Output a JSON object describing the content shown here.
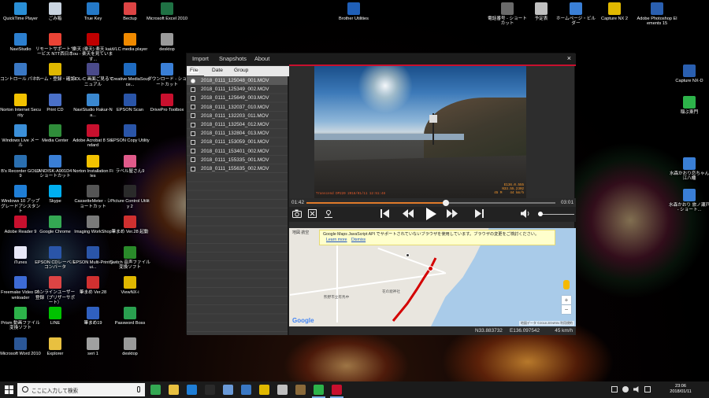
{
  "desktop": {
    "icons_col1": [
      {
        "label": "QuickTime Player",
        "color": "#2a8fd6"
      },
      {
        "label": "NaviStudio",
        "color": "#2c7fcf"
      },
      {
        "label": "コントロール パネル",
        "color": "#3a78c4"
      },
      {
        "label": "Norton Internet Security",
        "color": "#f2c200"
      },
      {
        "label": "Windows Live メール",
        "color": "#3b8fd8"
      },
      {
        "label": "B's Recorder GOLD9",
        "color": "#2a6fb0"
      },
      {
        "label": "Windows 10 アップグレードアシスタント",
        "color": "#1f7ed6"
      },
      {
        "label": "Adobe Reader 9",
        "color": "#c8102e"
      },
      {
        "label": "iTunes",
        "color": "#e8e8f8"
      },
      {
        "label": "Freemake Video Downloader",
        "color": "#3d6bd6"
      },
      {
        "label": "Prism 動画ファイル変換ソフト",
        "color": "#2db34a"
      },
      {
        "label": "Microsoft Word 2010",
        "color": "#2b5797"
      }
    ],
    "icons_col2": [
      {
        "label": "ごみ箱",
        "color": "#c9d4e0"
      },
      {
        "label": "リモートサポートサービス NTT西日本",
        "color": "#ea4335"
      },
      {
        "label": "ホーム・登録・確認",
        "color": "#e0b800"
      },
      {
        "label": "Print CD",
        "color": "#4a70c8"
      },
      {
        "label": "Media Center",
        "color": "#2f8d3a"
      },
      {
        "label": "LANDISK-A901D4 - ショートカット",
        "color": "#3a7fd6"
      },
      {
        "label": "Skype",
        "color": "#00aff0"
      },
      {
        "label": "Google Chrome",
        "color": "#34a853"
      },
      {
        "label": "EPSON CDレーベルコンバータ",
        "color": "#2a55a8"
      },
      {
        "label": "オンラインユーザー登録（プリザーサポート）",
        "color": "#d44"
      },
      {
        "label": "LINE",
        "color": "#00c300"
      },
      {
        "label": "Explorer",
        "color": "#e8c040"
      }
    ],
    "icons_col3": [
      {
        "label": "True Key",
        "color": "#2479c8"
      },
      {
        "label": "楽天 (楽天) 楽天 kaizou - 楽天を見ています...",
        "color": "#bf0000"
      },
      {
        "label": "HDL-C 画面ご見るマニュアル",
        "color": "#4a4a8a"
      },
      {
        "label": "NaviStudio Rakur-Na...",
        "color": "#3a88d0"
      },
      {
        "label": "Adobe Acrobat 8 Standard",
        "color": "#c8102e"
      },
      {
        "label": "Norton Installation Files",
        "color": "#f2c200"
      },
      {
        "label": "CassetteMeter - ショートカット",
        "color": "#555"
      },
      {
        "label": "Imaging WorkShop",
        "color": "#7a7a7a"
      },
      {
        "label": "EPSON Multi-PrintQui...",
        "color": "#2a55a8"
      },
      {
        "label": "筆まめ Ver.28",
        "color": "#d03030"
      },
      {
        "label": "筆まめ19",
        "color": "#3060c0"
      },
      {
        "label": "seri 1",
        "color": "#a0a0a0"
      }
    ],
    "icons_col4": [
      {
        "label": "Bectup",
        "color": "#dd4444"
      },
      {
        "label": "VLC media player",
        "color": "#f08a00"
      },
      {
        "label": "Creative MediaSource...",
        "color": "#1f6bc0"
      },
      {
        "label": "EPSON Scan",
        "color": "#2a55a8"
      },
      {
        "label": "EPSON Copy Utility",
        "color": "#2a55a8"
      },
      {
        "label": "ラベル屋さん9",
        "color": "#e05a8a"
      },
      {
        "label": "Picture Control Utility 2",
        "color": "#2a2a2a"
      },
      {
        "label": "筆まめ Ver.28 起動",
        "color": "#d03030"
      },
      {
        "label": "Switch 音声ファイル変換ソフト",
        "color": "#2a8a2a"
      },
      {
        "label": "ViewNX-i",
        "color": "#e0b800"
      },
      {
        "label": "Password Boss",
        "color": "#2aa050"
      },
      {
        "label": "desktop",
        "color": "#9a9a9a"
      }
    ],
    "icons_col5": [
      {
        "label": "Microsoft Excel 2010",
        "color": "#1f7244"
      },
      {
        "label": "desktop",
        "color": "#9a9a9a"
      },
      {
        "label": "ダウンロード - ショートカット",
        "color": "#3a7fd6"
      },
      {
        "label": "DrivePro Toolbox",
        "color": "#c8102e"
      }
    ],
    "icon_brother": {
      "label": "Brother Utilities",
      "color": "#1f5fb8"
    },
    "icons_topright": [
      {
        "label": "電話番号 - ショートカット",
        "color": "#6a6a6a"
      },
      {
        "label": "予定表",
        "color": "#c0c0c0"
      },
      {
        "label": "ホームページ・ビルダー",
        "color": "#3a7fd6"
      },
      {
        "label": "Capture NX 2",
        "color": "#e0b800"
      },
      {
        "label": "Adobe Photoshop Elements 15",
        "color": "#2a5fb0"
      }
    ],
    "icons_right": [
      {
        "label": "Capture NX-D",
        "color": "#2a5fb0"
      },
      {
        "label": "稲ぶ東門",
        "color": "#2db34a"
      },
      {
        "label": "水森かおり恋ちゃん江八幡",
        "color": "#3a7fd6"
      },
      {
        "label": "水森かおり 旅ノ瀬戸 - ショート...",
        "color": "#3a7fd6"
      }
    ]
  },
  "app": {
    "menu": [
      "Import",
      "Snapshots",
      "About"
    ],
    "close_label": "×",
    "tabs": [
      "File",
      "Date",
      "Group"
    ],
    "files": [
      "2018_0111_125048_001.MOV",
      "2018_0111_125349_002.MOV",
      "2018_0111_125649_003.MOV",
      "2018_0111_132037_010.MOV",
      "2018_0111_132203_011.MOV",
      "2018_0111_132504_012.MOV",
      "2018_0111_132804_013.MOV",
      "2018_0111_153059_001.MOV",
      "2018_0111_153401_002.MOV",
      "2018_0111_155335_001.MOV",
      "2018_0111_155635_002.MOV"
    ],
    "selected_file_index": 0,
    "video": {
      "overlay_left": "Transcend DP220 2018/01/11 12:51:48",
      "overlay_right": "E136.0.555\nN33.55.2302\n45 M    44 km/h"
    },
    "player": {
      "current_time": "01:42",
      "total_time": "03:01",
      "progress": 0.56,
      "volume": 0.0
    },
    "map": {
      "map_tabs": "地図   航空",
      "banner_text": "Google Maps JavaScript API でサポートされていないブラウザを使用しています。ブラウザの変更をご検討ください。",
      "learn_more": "Learn more",
      "dismiss": "Dismiss",
      "google_logo": "Google",
      "attribution": "地図データ ©2018 ZENRIN  利用規約",
      "place_labels": [
        "熊野市立有馬中",
        "花の窟神社"
      ],
      "zoom_in": "+",
      "zoom_out": "−"
    },
    "status": {
      "lat": "N33.883732",
      "lon": "E136.097542",
      "speed": "45 km/h"
    }
  },
  "taskbar": {
    "search_placeholder": "ここに入力して検索",
    "apps": [
      {
        "name": "Chrome",
        "color": "#34a853"
      },
      {
        "name": "Explorer",
        "color": "#e8c040"
      },
      {
        "name": "Edge",
        "color": "#1f7ed6"
      },
      {
        "name": "Capture NX",
        "color": "#2a2a2a"
      },
      {
        "name": "File",
        "color": "#6a9ad8"
      },
      {
        "name": "Folder",
        "color": "#3a78c4"
      },
      {
        "name": "ViewNX",
        "color": "#e0b800"
      },
      {
        "name": "Note",
        "color": "#c0c0c0"
      },
      {
        "name": "Media",
        "color": "#8a6a3a"
      },
      {
        "name": "NaviStudio",
        "color": "#2db34a"
      },
      {
        "name": "DrivePro",
        "color": "#c8102e"
      }
    ],
    "clock_time": "23:06",
    "clock_date": "2018/01/11"
  }
}
